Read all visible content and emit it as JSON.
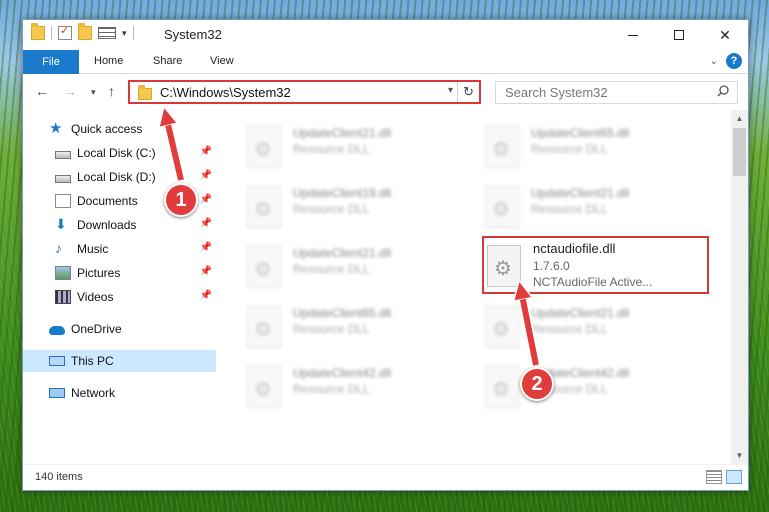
{
  "window": {
    "title": "System32",
    "buttons": {
      "minimize": "",
      "maximize": "",
      "close": "✕"
    }
  },
  "ribbon": {
    "tabs": [
      {
        "label": "File",
        "active": true
      },
      {
        "label": "Home"
      },
      {
        "label": "Share"
      },
      {
        "label": "View"
      }
    ]
  },
  "address_bar": {
    "path": "C:\\Windows\\System32",
    "refresh_glyph": "↻"
  },
  "search": {
    "placeholder": "Search System32"
  },
  "sidebar": {
    "items": [
      {
        "label": "Quick access",
        "icon": "star-icon",
        "pinned": false
      },
      {
        "label": "Local Disk (C:)",
        "icon": "disk-icon",
        "pinned": true
      },
      {
        "label": "Local Disk (D:)",
        "icon": "disk-icon",
        "pinned": true
      },
      {
        "label": "Documents",
        "icon": "documents-icon",
        "pinned": true
      },
      {
        "label": "Downloads",
        "icon": "download-icon",
        "pinned": true
      },
      {
        "label": "Music",
        "icon": "music-icon",
        "pinned": true
      },
      {
        "label": "Pictures",
        "icon": "pictures-icon",
        "pinned": true
      },
      {
        "label": "Videos",
        "icon": "videos-icon",
        "pinned": true
      },
      {
        "label": "OneDrive",
        "icon": "cloud-icon",
        "pinned": false
      },
      {
        "label": "This PC",
        "icon": "pc-icon",
        "pinned": false,
        "selected": true
      },
      {
        "label": "Network",
        "icon": "network-icon",
        "pinned": false
      }
    ]
  },
  "files": [
    {
      "name": "UpdateClient21.dll",
      "type": "Resource DLL"
    },
    {
      "name": "UpdateClient65.dll",
      "type": "Resource DLL"
    },
    {
      "name": "UpdateClient19.dll",
      "type": "Resource DLL"
    },
    {
      "name": "UpdateClient21.dll",
      "type": "Resource DLL"
    },
    {
      "name": "UpdateClient21.dll",
      "type": "Resource DLL"
    },
    {
      "name": "nctaudiofile.dll",
      "version": "1.7.6.0",
      "description": "NCTAudioFile Active...",
      "highlighted": true
    },
    {
      "name": "UpdateClient65.dll",
      "type": "Resource DLL"
    },
    {
      "name": "UpdateClient21.dll",
      "type": "Resource DLL"
    },
    {
      "name": "UpdateClient42.dll",
      "type": "Resource DLL"
    },
    {
      "name": "UpdateClient42.dll",
      "type": "Resource DLL"
    }
  ],
  "status": {
    "item_count": "140 items"
  },
  "callouts": [
    {
      "number": "1"
    },
    {
      "number": "2"
    }
  ],
  "colors": {
    "accent": "#1979ca",
    "annotation_red": "#d9383a",
    "selected_bg": "#cce8ff"
  }
}
